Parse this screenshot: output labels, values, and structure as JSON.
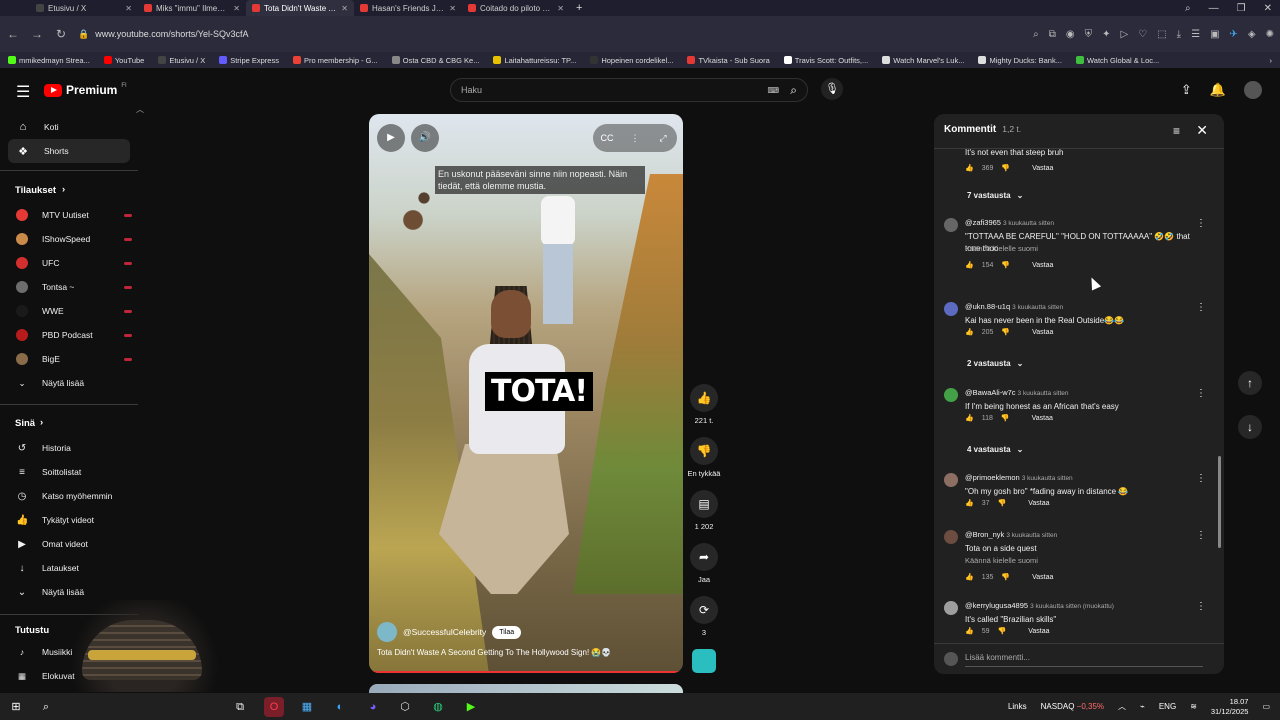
{
  "browser": {
    "tabs": [
      {
        "label": "Etusivu / X",
        "color": "#444"
      },
      {
        "label": "Miks \"immu\" Ilmen VS M...",
        "color": "#e53935"
      },
      {
        "label": "Tota Didn't Waste A Secon",
        "color": "#e53935",
        "active": true
      },
      {
        "label": "Hasan's Friends Just Exp",
        "color": "#e53935"
      },
      {
        "label": "Coitado do piloto da Mot",
        "color": "#e53935"
      }
    ],
    "new_tab": "+",
    "url": "www.youtube.com/shorts/Yel-SQv3cfA",
    "bookmarks": [
      {
        "label": "mmikedmayn Strea...",
        "color": "#53fc18"
      },
      {
        "label": "YouTube",
        "color": "#ff0000"
      },
      {
        "label": "Etusivu / X",
        "color": "#444"
      },
      {
        "label": "Stripe Express",
        "color": "#635bff"
      },
      {
        "label": "Pro membership - G...",
        "color": "#ea4335"
      },
      {
        "label": "Osta CBD & CBG Ke...",
        "color": "#888"
      },
      {
        "label": "Laitahattureissu: TP...",
        "color": "#e6c200"
      },
      {
        "label": "Hopeinen cordelikel...",
        "color": "#333"
      },
      {
        "label": "TVkaista - Sub Suora",
        "color": "#e53935"
      },
      {
        "label": "Travis Scott: Outfits,...",
        "color": "#fff"
      },
      {
        "label": "Watch Marvel's Luk...",
        "color": "#ddd"
      },
      {
        "label": "Mighty Ducks: Bank...",
        "color": "#ddd"
      },
      {
        "label": "Watch Global & Loc...",
        "color": "#3fbf3f"
      }
    ]
  },
  "youtube": {
    "logo_text": "Premium",
    "logo_sup": "FI",
    "search_placeholder": "Haku",
    "search_kbd": "⌨",
    "sidebar": {
      "main": [
        {
          "label": "Koti",
          "icon": "home-icon",
          "glyph": "⌂"
        },
        {
          "label": "Shorts",
          "icon": "shorts-icon",
          "glyph": "❖",
          "active": true
        }
      ],
      "subs_title": "Tilaukset",
      "subs": [
        {
          "label": "MTV Uutiset",
          "color": "#e53935"
        },
        {
          "label": "IShowSpeed",
          "color": "#c98a4a"
        },
        {
          "label": "UFC",
          "color": "#d32f2f"
        },
        {
          "label": "Tontsa ~",
          "color": "#6d6d6d"
        },
        {
          "label": "WWE",
          "color": "#1a1a1a"
        },
        {
          "label": "PBD Podcast",
          "color": "#b71c1c"
        },
        {
          "label": "BigE",
          "color": "#8a6b4a"
        }
      ],
      "subs_more": "Näytä lisää",
      "you_title": "Sinä",
      "you": [
        {
          "label": "Historia",
          "icon": "history-icon",
          "glyph": "↺"
        },
        {
          "label": "Soittolistat",
          "icon": "playlist-icon",
          "glyph": "≡"
        },
        {
          "label": "Katso myöhemmin",
          "icon": "watch-later-icon",
          "glyph": "◷"
        },
        {
          "label": "Tykätyt videot",
          "icon": "liked-icon",
          "glyph": "👍"
        },
        {
          "label": "Omat videot",
          "icon": "my-videos-icon",
          "glyph": "▶"
        },
        {
          "label": "Lataukset",
          "icon": "download-icon",
          "glyph": "↓"
        },
        {
          "label": "Näytä lisää",
          "icon": "chevron-down-icon",
          "glyph": "⌄"
        }
      ],
      "explore_title": "Tutustu",
      "explore": [
        {
          "label": "Musiikki",
          "icon": "music-icon",
          "glyph": "♪"
        },
        {
          "label": "Elokuvat",
          "icon": "movies-icon",
          "glyph": "▦"
        }
      ]
    },
    "video": {
      "subtitle": "En uskonut pääseväni sinne niin nopeasti. Näin tiedät, että olemme mustia.",
      "caption": "TOTA!",
      "channel": "@SuccessfulCelebrity",
      "subscribe": "Tilaa",
      "title": "Tota Didn't Waste A Second Getting To The Hollywood Sign! 😭💀",
      "cc": "CC"
    },
    "actions": {
      "likes": "221 t.",
      "dislike": "En tykkää",
      "comments": "1 202",
      "share": "Jaa",
      "remix": "3"
    },
    "comments_panel": {
      "title": "Kommentit",
      "count": "1,2 t.",
      "top_text": "It's not even that steep bruh",
      "top_likes": "369",
      "reply_label": "Vastaa",
      "translate_label": "Käännä kielelle suomi",
      "add_placeholder": "Lisää kommentti...",
      "reply_toggles": [
        "7 vastausta",
        "2 vastausta",
        "4 vastausta"
      ],
      "items": [
        {
          "user": "@zafi3965",
          "time": "3 kuukautta sitten",
          "text": "\"TOTTAAA BE CAREFUL\" \"HOLD ON TOTTAAAAA\" 🤣🤣 that tone thoo",
          "likes": "154",
          "translate": true,
          "color": "#666"
        },
        {
          "user": "@ukn.88-u1q",
          "time": "3 kuukautta sitten",
          "text": "Kai has never been in the Real Outside😂😂",
          "likes": "205",
          "translate": false,
          "color": "#5c6bc0"
        },
        {
          "user": "@BawaAli-w7c",
          "time": "3 kuukautta sitten",
          "text": "If I'm being honest as an African that's easy",
          "likes": "118",
          "translate": false,
          "color": "#43a047"
        },
        {
          "user": "@primoeklemon",
          "time": "3 kuukautta sitten",
          "text": "\"Oh my gosh bro\" *fading away in distance 😂",
          "likes": "37",
          "translate": false,
          "color": "#8d6e63"
        },
        {
          "user": "@Bron_nyk",
          "time": "3 kuukautta sitten",
          "text": "Tota on a side quest",
          "likes": "135",
          "translate": true,
          "color": "#6d4c41"
        },
        {
          "user": "@kerrylugusa4895",
          "time": "3 kuukautta sitten (muokattu)",
          "text": "It's called \"Brazilian skills\"",
          "likes": "59",
          "translate": false,
          "color": "#9e9e9e"
        }
      ]
    }
  },
  "taskbar": {
    "links": "Links",
    "ticker": "NASDAQ",
    "ticker_change": "−0,35%",
    "lang": "ENG",
    "time": "18.07",
    "date": "31/12/2025"
  }
}
